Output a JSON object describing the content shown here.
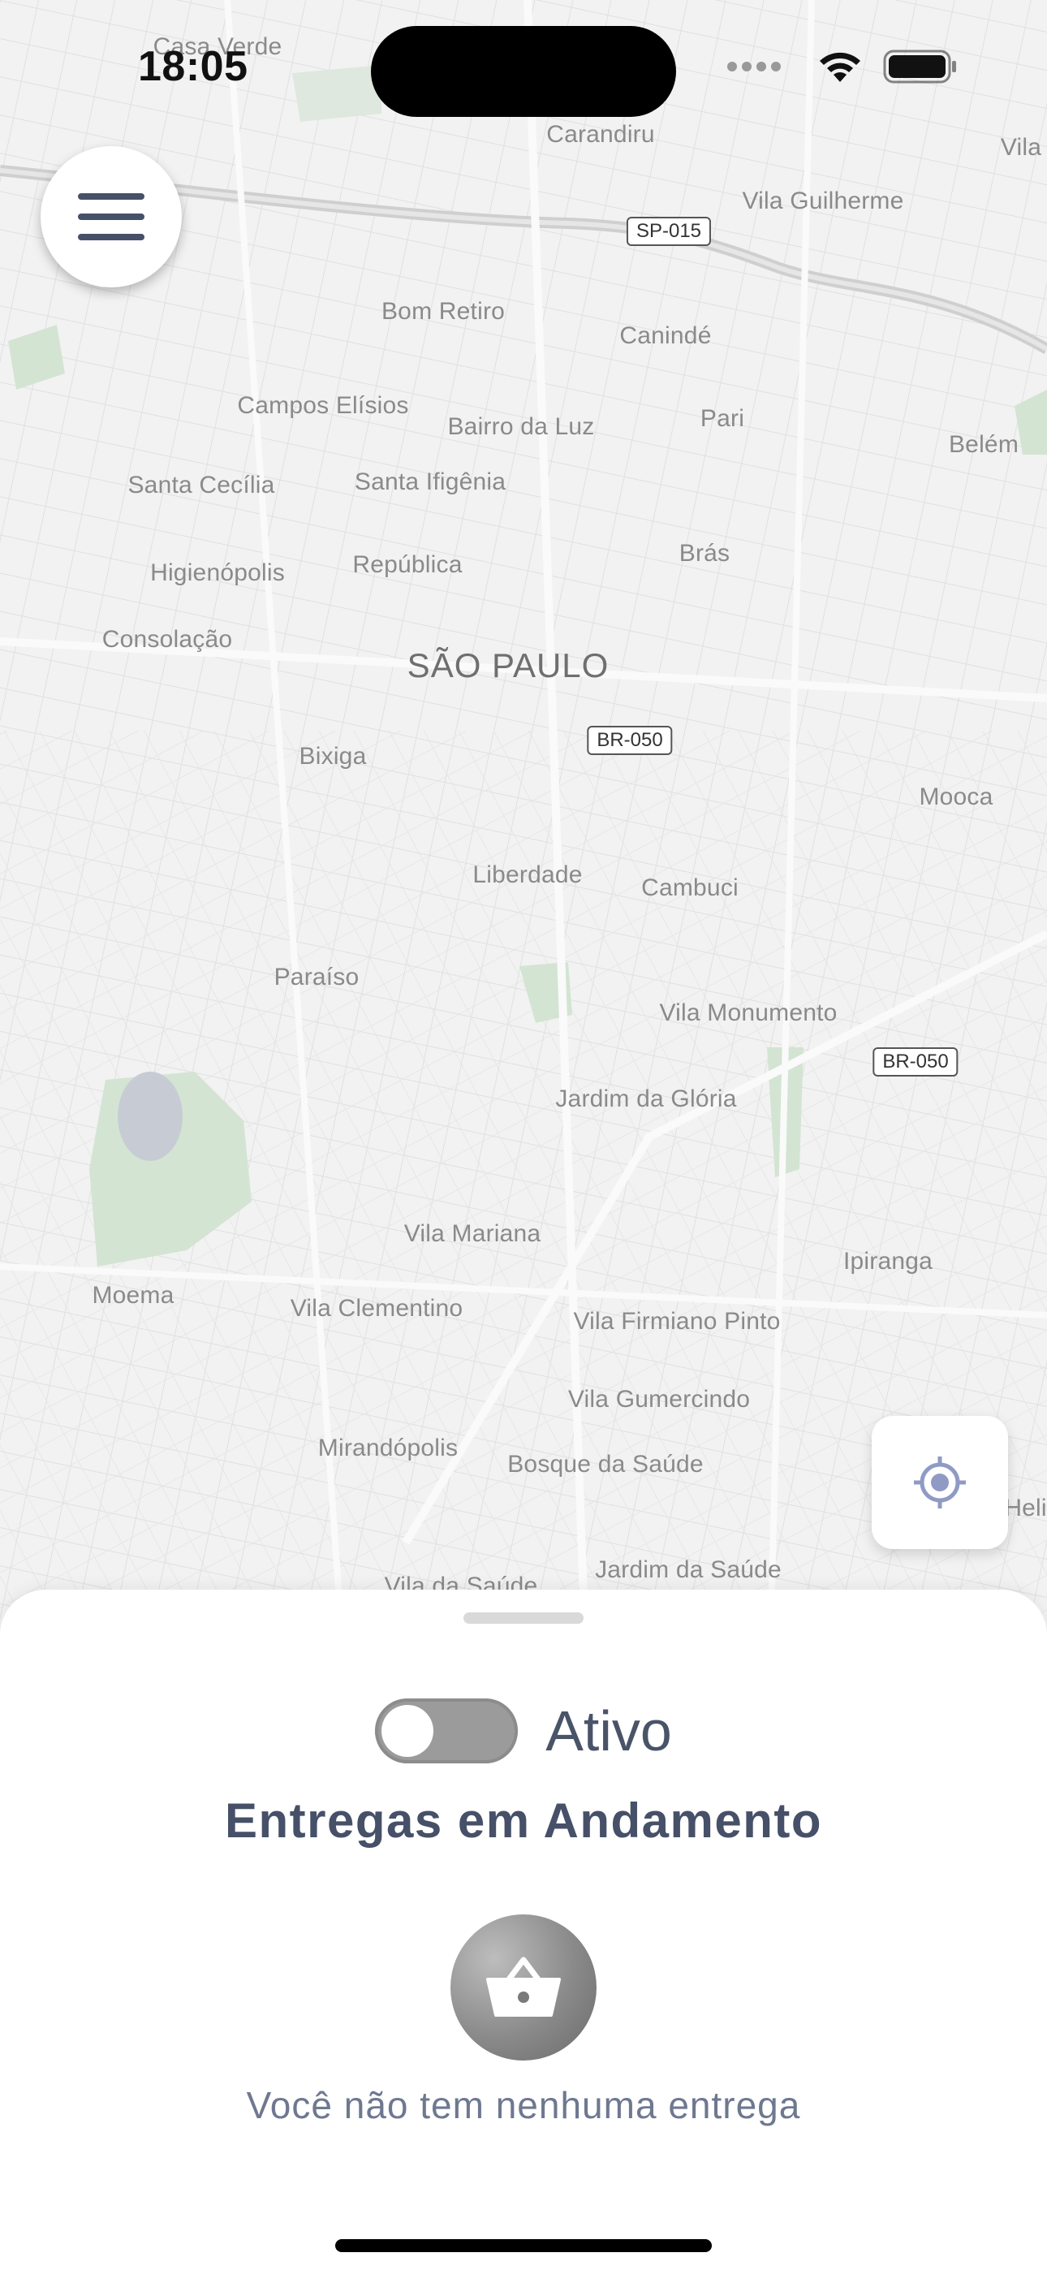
{
  "status_bar": {
    "time": "18:05"
  },
  "map": {
    "city_label": "SÃO PAULO",
    "labels": [
      "Casa Verde",
      "Carandiru",
      "Vila",
      "Vila Guilherme",
      "Bom Retiro",
      "Canindé",
      "Campos Elísios",
      "Bairro da Luz",
      "Pari",
      "Belém",
      "Santa Cecília",
      "Santa Ifigênia",
      "Higienópolis",
      "República",
      "Brás",
      "Consolação",
      "Bixiga",
      "Mooca",
      "Liberdade",
      "Cambuci",
      "Paraíso",
      "Vila Monumento",
      "Jardim da Glória",
      "Vila Mariana",
      "Ipiranga",
      "Moema",
      "Vila Clementino",
      "Vila Firmiano Pinto",
      "Vila Gumercindo",
      "Mirandópolis",
      "Bosque da Saúde",
      "Helio",
      "Jardim da Saúde",
      "Vila da Saúde"
    ],
    "road_shields": [
      "SP-015",
      "BR-050",
      "BR-050"
    ]
  },
  "buttons": {
    "menu_icon": "hamburger-menu-icon",
    "locate_icon": "crosshair-location-icon"
  },
  "sheet": {
    "toggle_label": "Ativo",
    "toggle_on": false,
    "title": "Entregas em Andamento",
    "empty_icon": "shopping-basket-icon",
    "empty_text": "Você não tem nenhuma entrega"
  },
  "colors": {
    "accent": "#465068",
    "muted_text": "#6e7890",
    "toggle_off": "#9b9b9b",
    "map_bg": "#f1f1f1"
  }
}
